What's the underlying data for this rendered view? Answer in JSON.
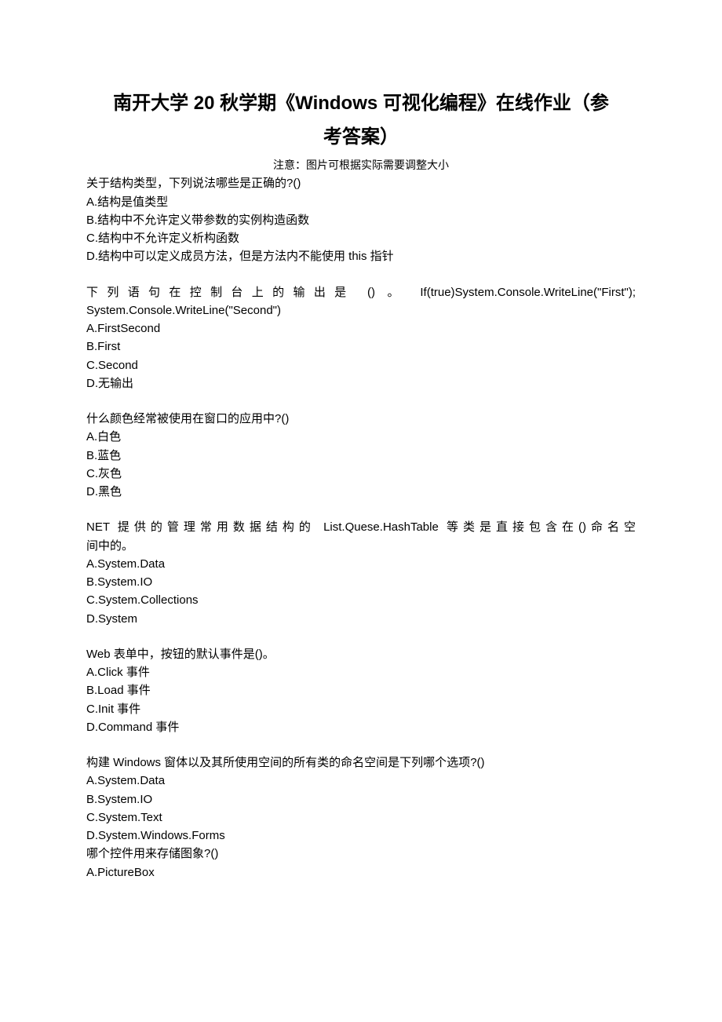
{
  "title_line1": "南开大学 20 秋学期《Windows 可视化编程》在线作业（参",
  "title_line2": "考答案）",
  "note": "注意：图片可根据实际需要调整大小",
  "questions": [
    {
      "text": "关于结构类型，下列说法哪些是正确的?()",
      "options": [
        "A.结构是值类型",
        "B.结构中不允许定义带参数的实例构造函数",
        "C.结构中不允许定义析构函数",
        "D.结构中可以定义成员方法，但是方法内不能使用 this 指针"
      ]
    },
    {
      "text_line1": "下列语句在控制台上的输出是 () 。 If(true)System.Console.WriteLine(\"First\");",
      "text_line2": "System.Console.WriteLine(\"Second\")",
      "options": [
        "A.FirstSecond",
        "B.First",
        "C.Second",
        "D.无输出"
      ]
    },
    {
      "text": "什么颜色经常被使用在窗口的应用中?()",
      "options": [
        "A.白色",
        "B.蓝色",
        "C.灰色",
        "D.黑色"
      ]
    },
    {
      "text_line1": "NET 提供的管理常用数据结构的 List.Quese.HashTable 等类是直接包含在()命名空",
      "text_line2": "间中的。",
      "options": [
        "A.System.Data",
        "B.System.IO",
        "C.System.Collections",
        "D.System"
      ]
    },
    {
      "text": "Web 表单中，按钮的默认事件是()。",
      "options": [
        "A.Click 事件",
        "B.Load 事件",
        "C.Init 事件",
        "D.Command 事件"
      ]
    },
    {
      "text": "构建 Windows 窗体以及其所使用空间的所有类的命名空间是下列哪个选项?()",
      "options": [
        "A.System.Data",
        "B.System.IO",
        "C.System.Text",
        "D.System.Windows.Forms"
      ]
    },
    {
      "text": "哪个控件用来存储图象?()",
      "options": [
        "A.PictureBox"
      ]
    }
  ]
}
